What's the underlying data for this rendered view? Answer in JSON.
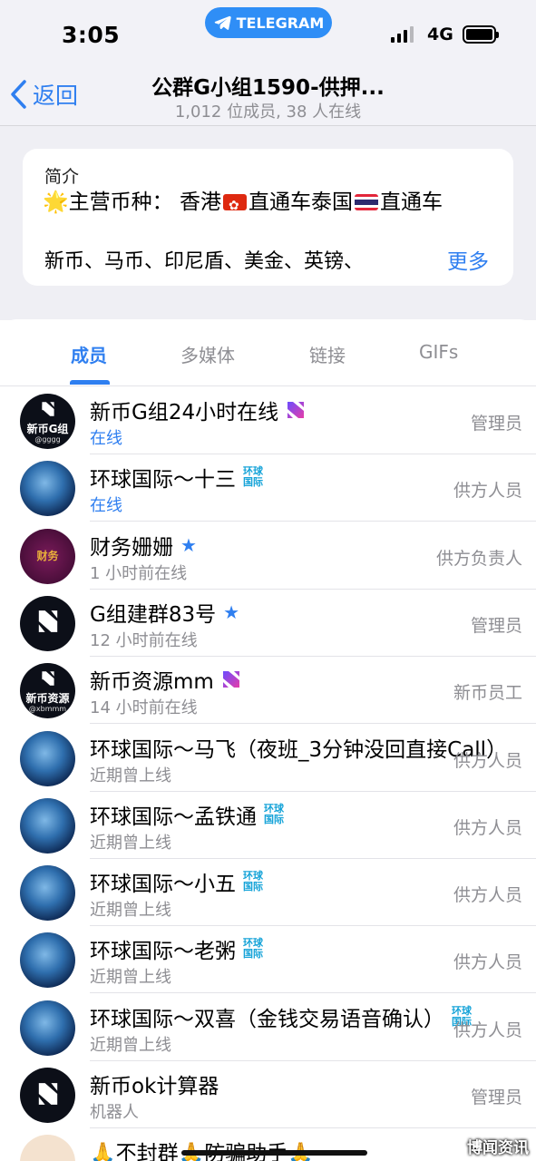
{
  "status_bar": {
    "time": "3:05",
    "app_pill": "TELEGRAM",
    "network": "4G"
  },
  "nav": {
    "back_label": "返回",
    "title": "公群G小组1590-供押...",
    "subtitle": "1,012 位成员, 38 人在线"
  },
  "intro": {
    "label": "简介",
    "line1_a": "主营币种： 香港",
    "line1_b": "直通车泰国",
    "line1_c": "直通车",
    "line3": "新币、马币、印尼盾、美金、英镑、",
    "more": "更多"
  },
  "tabs": [
    {
      "label": "成员",
      "active": true
    },
    {
      "label": "多媒体",
      "active": false
    },
    {
      "label": "链接",
      "active": false
    },
    {
      "label": "GIFs",
      "active": false
    }
  ],
  "members": [
    {
      "name": "新币G组24小时在线",
      "status": "在线",
      "online": true,
      "role": "管理员",
      "avatar": "black",
      "avatar_text": "新币G组",
      "avatar_sub": "@gggg",
      "badge": "n-icon"
    },
    {
      "name": "环球国际～十三",
      "status": "在线",
      "online": true,
      "role": "供方人员",
      "avatar": "globe",
      "badge": "hq-icon"
    },
    {
      "name": "财务姗姗",
      "status": "1 小时前在线",
      "online": false,
      "role": "供方负责人",
      "avatar": "purple",
      "avatar_text": "财务",
      "badge": "star-icon"
    },
    {
      "name": "G组建群83号",
      "status": "12 小时前在线",
      "online": false,
      "role": "管理员",
      "avatar": "black-logo",
      "badge": "star-icon"
    },
    {
      "name": "新币资源mm",
      "status": "14 小时前在线",
      "online": false,
      "role": "新币员工",
      "avatar": "black",
      "avatar_text": "新币资源",
      "avatar_sub": "@xbmmm",
      "badge": "n-icon"
    },
    {
      "name": "环球国际～马飞（夜班_3分钟没回直接Call）",
      "status": "近期曾上线",
      "online": false,
      "role": "供方人员",
      "avatar": "globe",
      "badge": ""
    },
    {
      "name": "环球国际～孟铁通",
      "status": "近期曾上线",
      "online": false,
      "role": "供方人员",
      "avatar": "globe",
      "badge": "hq-icon"
    },
    {
      "name": "环球国际～小五",
      "status": "近期曾上线",
      "online": false,
      "role": "供方人员",
      "avatar": "globe",
      "badge": "hq-icon"
    },
    {
      "name": "环球国际～老粥",
      "status": "近期曾上线",
      "online": false,
      "role": "供方人员",
      "avatar": "globe",
      "badge": "hq-icon"
    },
    {
      "name": "环球国际～双喜（金钱交易语音确认）",
      "status": "近期曾上线",
      "online": false,
      "role": "供方人员",
      "avatar": "globe",
      "badge": "hq-icon"
    },
    {
      "name": "新币ok计算器",
      "status": "机器人",
      "online": false,
      "role": "管理员",
      "avatar": "black-logo",
      "badge": ""
    },
    {
      "name": "🙏不封群🙏防骗助手🙏",
      "status": "",
      "online": false,
      "role": "",
      "avatar": "cream",
      "badge": ""
    }
  ],
  "badge_hq_text": [
    "环球",
    "国际"
  ],
  "watermark": "博闻资讯",
  "colors": {
    "accent": "#2f7ff0",
    "telegram_pill": "#2f8ef6",
    "muted": "#8e8e93",
    "badge_hq": "#15a3d8"
  }
}
